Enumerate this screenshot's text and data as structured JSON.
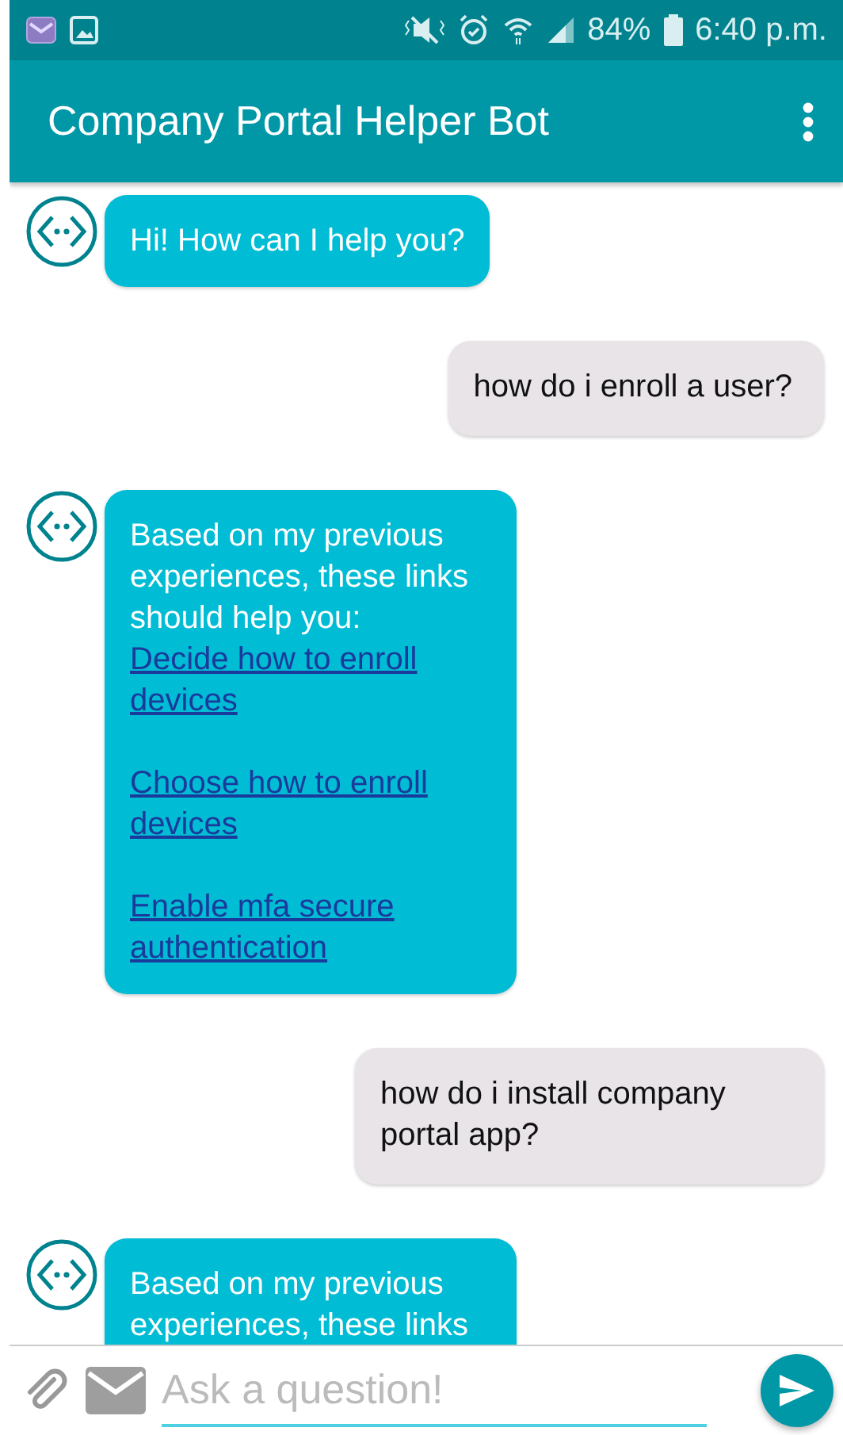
{
  "status_bar": {
    "battery": "84%",
    "time": "6:40 p.m."
  },
  "app_bar": {
    "title": "Company Portal Helper Bot"
  },
  "messages": [
    {
      "kind": "bot",
      "lines": [
        "Hi! How can I help you?"
      ]
    },
    {
      "kind": "user",
      "lines": [
        "how do i enroll a user?"
      ]
    },
    {
      "kind": "bot",
      "lines": [
        "Based on my previous experiences, these links should help you:"
      ],
      "links": [
        "Decide how to enroll devices",
        "Choose how to enroll devices",
        "Enable mfa secure authentication"
      ]
    },
    {
      "kind": "user",
      "lines": [
        "how do i install company portal app?"
      ]
    },
    {
      "kind": "bot",
      "lines": [
        "Based on my previous experiences, these links"
      ]
    }
  ],
  "composer": {
    "placeholder": "Ask a question!"
  }
}
